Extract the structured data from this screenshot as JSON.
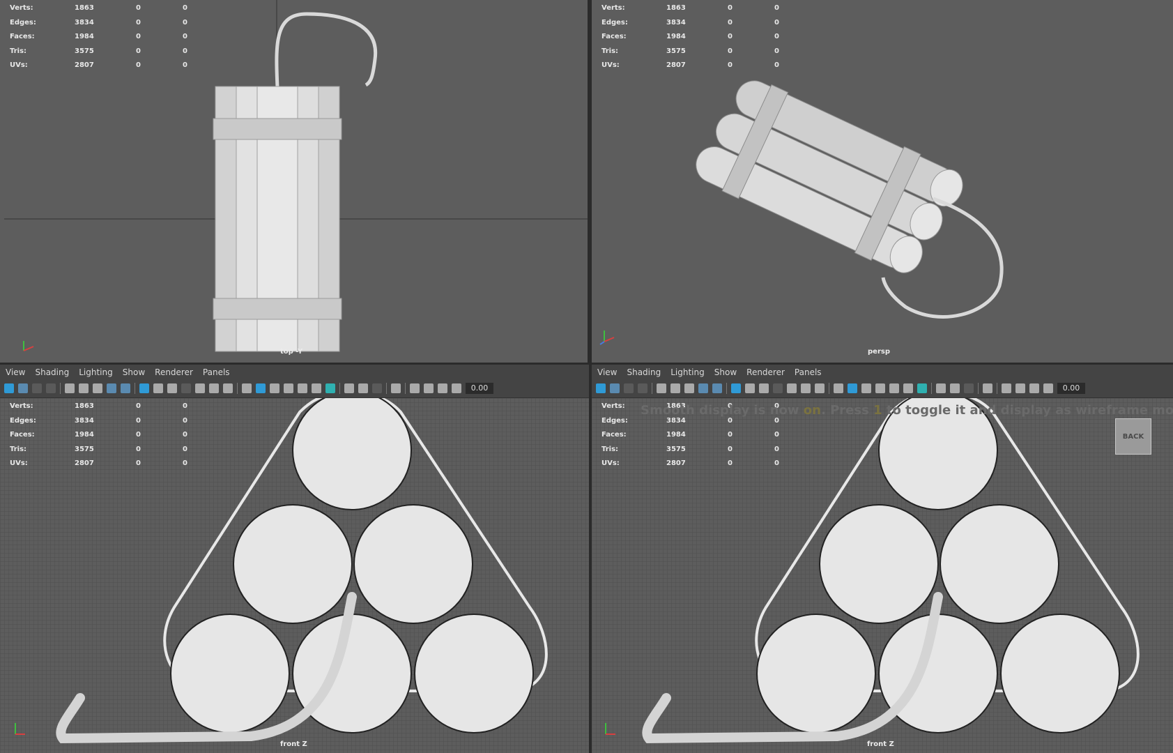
{
  "stats": {
    "rows": [
      {
        "label": "Verts:",
        "a": "1863",
        "b": "0",
        "c": "0"
      },
      {
        "label": "Edges:",
        "a": "3834",
        "b": "0",
        "c": "0"
      },
      {
        "label": "Faces:",
        "a": "1984",
        "b": "0",
        "c": "0"
      },
      {
        "label": "Tris:",
        "a": "3575",
        "b": "0",
        "c": "0"
      },
      {
        "label": "UVs:",
        "a": "2807",
        "b": "0",
        "c": "0"
      }
    ]
  },
  "viewports": {
    "top": {
      "camera": "top -Y"
    },
    "persp": {
      "camera": "persp"
    },
    "front_left": {
      "camera": "front Z"
    },
    "front_right": {
      "camera": "front Z"
    }
  },
  "menu": {
    "view": "View",
    "shading": "Shading",
    "lighting": "Lighting",
    "show": "Show",
    "renderer": "Renderer",
    "panels": "Panels"
  },
  "toolbar": {
    "value": "0.00"
  },
  "overlay": {
    "back_label": "BACK",
    "message_parts": [
      "Smooth display is now",
      "on",
      ". Press",
      "1",
      "to toggle it and display as wireframe mode"
    ]
  },
  "colors": {
    "viewport_bg": "#5d5d5d",
    "grid_line": "#4e4e4e",
    "model": "#dcdcdc",
    "accent_icon": "#2f9ad6"
  },
  "icons": [
    "axis-gizmo-icon",
    "select-icon",
    "camera-icon",
    "grid-icon",
    "shading-icon",
    "light-icon"
  ]
}
